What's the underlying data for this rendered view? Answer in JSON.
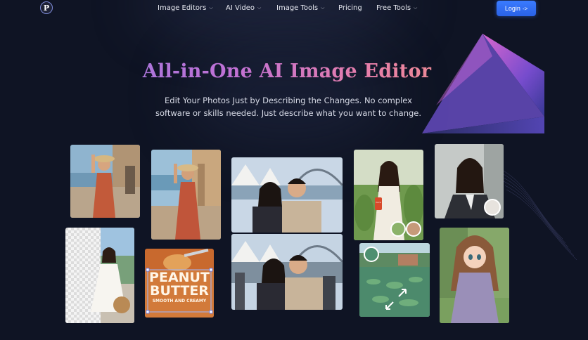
{
  "header": {
    "logo_letter": "P",
    "nav": [
      {
        "label": "Image Editors",
        "has_dropdown": true
      },
      {
        "label": "AI Video",
        "has_dropdown": true
      },
      {
        "label": "Image Tools",
        "has_dropdown": true
      },
      {
        "label": "Pricing",
        "has_dropdown": false
      },
      {
        "label": "Free Tools",
        "has_dropdown": true
      }
    ],
    "login_label": "Login",
    "login_arrow": "->"
  },
  "hero": {
    "title": "All-in-One AI Image Editor",
    "subtitle_line1": "Edit Your Photos Just by Describing the Changes. No complex",
    "subtitle_line2": "software or skills needed. Just describe what you want to change."
  },
  "gallery": {
    "peanut_line1": "PEANUT",
    "peanut_line2": "BUTTER",
    "peanut_line3": "SMOOTH AND CREAMY",
    "can_text": "Coca"
  },
  "colors": {
    "background": "#0f1424",
    "login": "#2f6cf2",
    "title_gradient_start": "#8a7be0",
    "title_gradient_end": "#f3a070"
  }
}
